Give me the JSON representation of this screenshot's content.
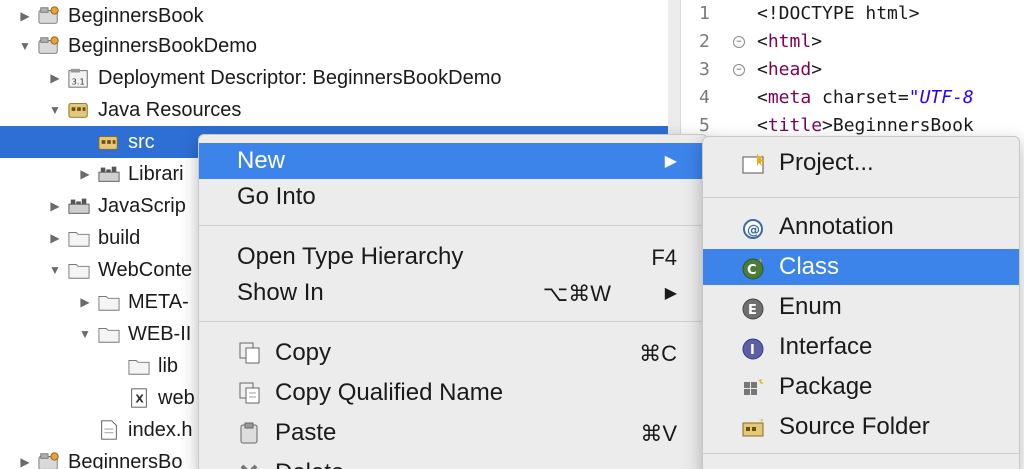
{
  "tree": [
    {
      "label": "BeginnersBook",
      "arrow": "right",
      "icon": "project-icon",
      "indent": 0
    },
    {
      "label": "BeginnersBookDemo",
      "arrow": "down",
      "icon": "project-icon",
      "indent": 0
    },
    {
      "label": "Deployment Descriptor: BeginnersBookDemo",
      "arrow": "right",
      "icon": "descriptor-icon",
      "indent": 1
    },
    {
      "label": "Java Resources",
      "arrow": "down",
      "icon": "java-resources-icon",
      "indent": 1
    },
    {
      "label": "src",
      "arrow": "",
      "icon": "source-package-icon",
      "indent": 2,
      "selected": true
    },
    {
      "label": "Librari",
      "arrow": "right",
      "icon": "library-icon",
      "indent": 2
    },
    {
      "label": "JavaScrip",
      "arrow": "right",
      "icon": "library-icon",
      "indent": 1
    },
    {
      "label": "build",
      "arrow": "right",
      "icon": "folder-icon",
      "indent": 1
    },
    {
      "label": "WebConte",
      "arrow": "down",
      "icon": "folder-icon",
      "indent": 1
    },
    {
      "label": "META-",
      "arrow": "right",
      "icon": "folder-icon",
      "indent": 2
    },
    {
      "label": "WEB-II",
      "arrow": "down",
      "icon": "folder-icon",
      "indent": 2
    },
    {
      "label": "lib",
      "arrow": "",
      "icon": "folder-icon",
      "indent": 3
    },
    {
      "label": "web",
      "arrow": "",
      "icon": "xml-file-icon",
      "indent": 3
    },
    {
      "label": "index.h",
      "arrow": "",
      "icon": "file-icon",
      "indent": 2
    },
    {
      "label": "BeginnersBo",
      "arrow": "right",
      "icon": "project-icon",
      "indent": 0
    }
  ],
  "editor": {
    "lines": [
      {
        "num": "1",
        "fold": false,
        "segments": [
          {
            "t": "<!DOCTYPE html>",
            "c": "plain"
          }
        ]
      },
      {
        "num": "2",
        "fold": true,
        "segments": [
          {
            "t": "<",
            "c": "plain"
          },
          {
            "t": "html",
            "c": "kw"
          },
          {
            "t": ">",
            "c": "plain"
          }
        ]
      },
      {
        "num": "3",
        "fold": true,
        "segments": [
          {
            "t": "<",
            "c": "plain"
          },
          {
            "t": "head",
            "c": "kw"
          },
          {
            "t": ">",
            "c": "plain"
          }
        ]
      },
      {
        "num": "4",
        "fold": false,
        "segments": [
          {
            "t": "<",
            "c": "plain"
          },
          {
            "t": "meta ",
            "c": "kw"
          },
          {
            "t": "charset=",
            "c": "plain"
          },
          {
            "t": "\"UTF-8",
            "c": "str"
          }
        ]
      },
      {
        "num": "5",
        "fold": false,
        "segments": [
          {
            "t": "<",
            "c": "plain"
          },
          {
            "t": "title",
            "c": "kw"
          },
          {
            "t": ">BeginnersBook",
            "c": "plain"
          }
        ]
      }
    ]
  },
  "context_menu": {
    "items": [
      {
        "label": "New",
        "shortcut": "",
        "submenu": true,
        "highlighted": true,
        "icon": ""
      },
      {
        "label": "Go Into",
        "shortcut": "",
        "submenu": false,
        "icon": ""
      },
      {
        "separator": true
      },
      {
        "label": "Open Type Hierarchy",
        "shortcut": "F4",
        "submenu": false,
        "icon": ""
      },
      {
        "label": "Show In",
        "shortcut": "⌥⌘W",
        "submenu": true,
        "icon": ""
      },
      {
        "separator": true
      },
      {
        "label": "Copy",
        "shortcut": "⌘C",
        "submenu": false,
        "icon": "copy-icon"
      },
      {
        "label": "Copy Qualified Name",
        "shortcut": "",
        "submenu": false,
        "icon": "copy-qualified-icon"
      },
      {
        "label": "Paste",
        "shortcut": "⌘V",
        "submenu": false,
        "icon": "paste-icon"
      },
      {
        "label": "Delete",
        "shortcut": "",
        "submenu": false,
        "icon": "delete-icon"
      }
    ]
  },
  "new_submenu": {
    "items": [
      {
        "label": "Project...",
        "icon": "new-project-icon"
      },
      {
        "separator": true
      },
      {
        "label": "Annotation",
        "icon": "annotation-icon"
      },
      {
        "label": "Class",
        "icon": "class-icon",
        "highlighted": true
      },
      {
        "label": "Enum",
        "icon": "enum-icon"
      },
      {
        "label": "Interface",
        "icon": "interface-icon"
      },
      {
        "label": "Package",
        "icon": "package-icon"
      },
      {
        "label": "Source Folder",
        "icon": "source-folder-icon"
      },
      {
        "separator": true
      }
    ]
  },
  "colors": {
    "selection": "#2e6fd6",
    "menu_highlight": "#3d84ea",
    "menu_bg": "#ececec"
  }
}
